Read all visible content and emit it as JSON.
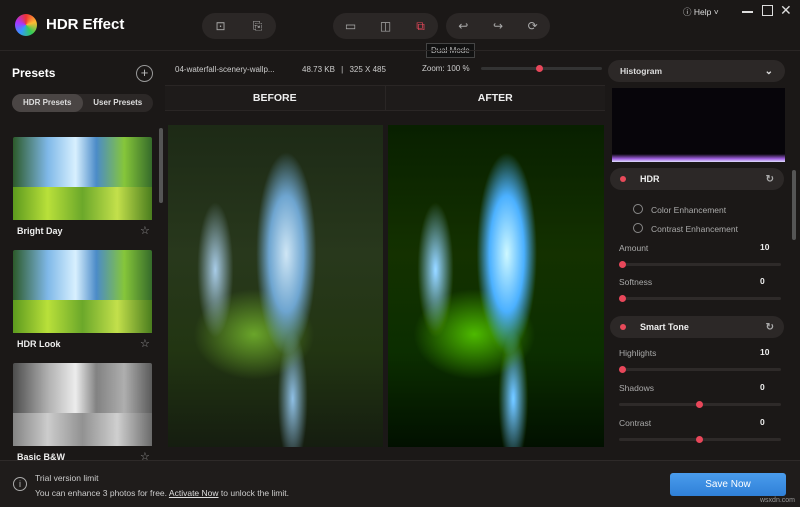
{
  "app": {
    "title": "HDR Effect",
    "help": "Help"
  },
  "toolbar": {
    "tooltip": "Dual Mode",
    "active_mode": "dual-mode",
    "accent": "#e8475a"
  },
  "sidebar": {
    "title": "Presets",
    "tabs": [
      {
        "label": "HDR Presets",
        "active": true
      },
      {
        "label": "User Presets",
        "active": false
      }
    ],
    "presets": [
      {
        "label": "Bright Day"
      },
      {
        "label": "HDR Look"
      },
      {
        "label": "Basic B&W"
      }
    ]
  },
  "file": {
    "name": "04-waterfall-scenery-wallp...",
    "size": "48.73 KB",
    "separator": "|",
    "dimensions": "325 X 485",
    "zoom_label": "Zoom:",
    "zoom_value": "100 %",
    "zoom_percent": 100
  },
  "view": {
    "before": "BEFORE",
    "after": "AFTER"
  },
  "panel": {
    "dropdown": "Histogram",
    "hdr": {
      "title": "HDR",
      "options": [
        "Color Enhancement",
        "Contrast Enhancement"
      ],
      "sliders": [
        {
          "label": "Amount",
          "value": "10",
          "pos": 0
        },
        {
          "label": "Softness",
          "value": "0",
          "pos": 0
        }
      ]
    },
    "smart_tone": {
      "title": "Smart Tone",
      "sliders": [
        {
          "label": "Highlights",
          "value": "10",
          "pos": 0
        },
        {
          "label": "Shadows",
          "value": "0",
          "pos": 0.5
        },
        {
          "label": "Contrast",
          "value": "0",
          "pos": 0.5
        }
      ]
    }
  },
  "footer": {
    "title": "Trial version limit",
    "msg_pre": "You can enhance 3 photos for free.",
    "link": "Activate Now",
    "msg_post": "to unlock the limit.",
    "save": "Save Now",
    "save_color": "#3d8fe0"
  },
  "watermark": "wsxdn.com"
}
